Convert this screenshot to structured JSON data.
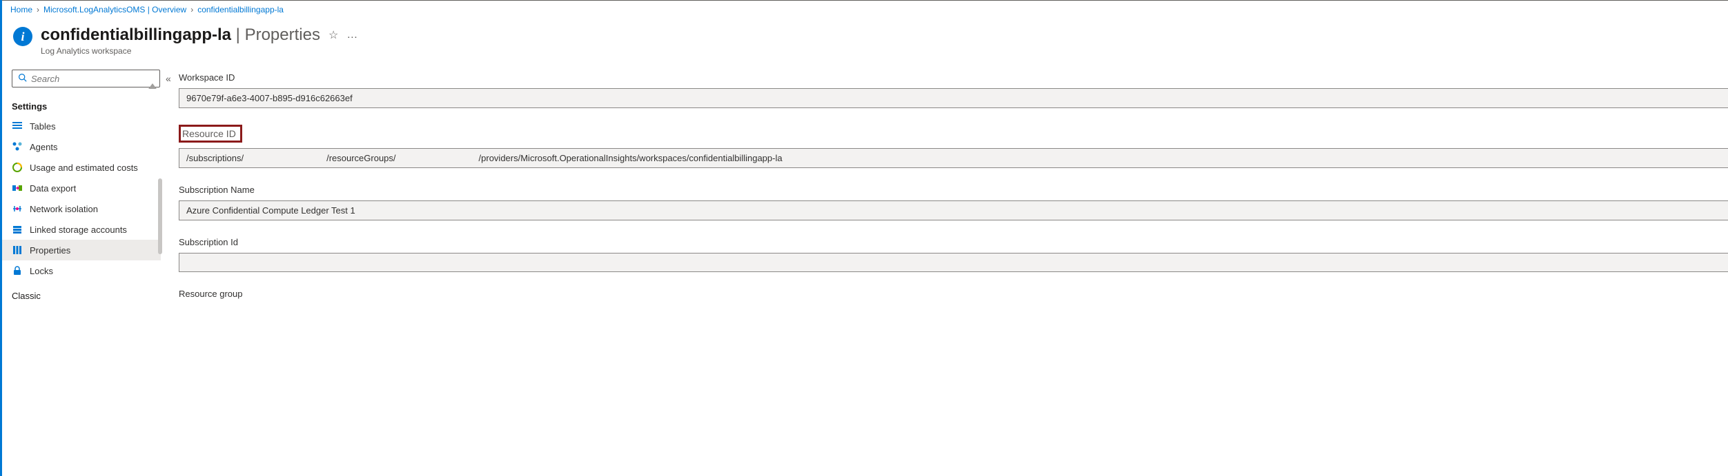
{
  "breadcrumb": {
    "home": "Home",
    "mid": "Microsoft.LogAnalyticsOMS | Overview",
    "current": "confidentialbillingapp-la"
  },
  "header": {
    "title_main": "confidentialbillingapp-la",
    "title_sep": " | ",
    "title_section": "Properties",
    "subtitle": "Log Analytics workspace"
  },
  "search": {
    "placeholder": "Search"
  },
  "sidebar": {
    "section_label": "Settings",
    "items": [
      {
        "label": "Tables"
      },
      {
        "label": "Agents"
      },
      {
        "label": "Usage and estimated costs"
      },
      {
        "label": "Data export"
      },
      {
        "label": "Network isolation"
      },
      {
        "label": "Linked storage accounts"
      },
      {
        "label": "Properties"
      },
      {
        "label": "Locks"
      }
    ],
    "footer_label": "Classic"
  },
  "main": {
    "workspace_id": {
      "label": "Workspace ID",
      "value": "9670e79f-a6e3-4007-b895-d916c62663ef"
    },
    "resource_id": {
      "label": "Resource ID",
      "part1": "/subscriptions/",
      "part2": "/resourceGroups/",
      "part3": "/providers/Microsoft.OperationalInsights/workspaces/confidentialbillingapp-la"
    },
    "subscription_name": {
      "label": "Subscription Name",
      "value": "Azure Confidential Compute Ledger Test 1"
    },
    "subscription_id": {
      "label": "Subscription Id",
      "value": ""
    },
    "resource_group": {
      "label": "Resource group"
    }
  }
}
